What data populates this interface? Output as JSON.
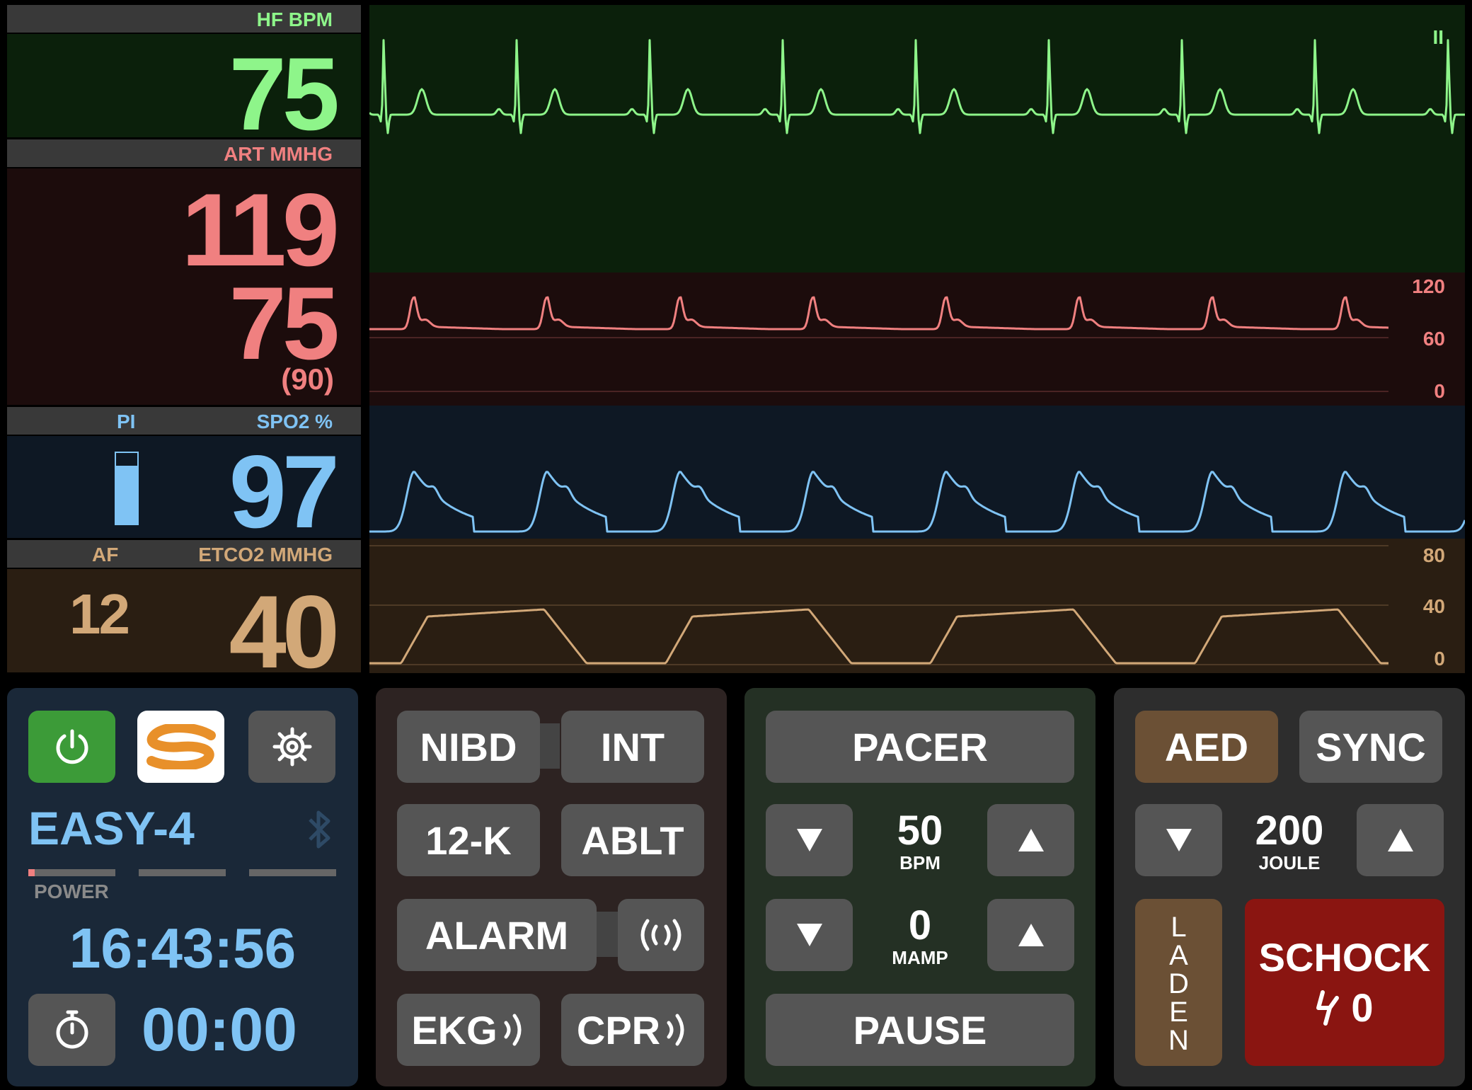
{
  "colors": {
    "hr": "#8ef58a",
    "art": "#f08080",
    "spo2": "#7fc3f4",
    "etco2": "#d2a878",
    "power_green": "#3c9b38",
    "aed_brown": "#6b5035",
    "schock_red": "#8a1511",
    "clock_blue": "#7fc3f4"
  },
  "hr": {
    "label": "HF  BPM",
    "value": "75"
  },
  "art": {
    "label": "ART  MMHG",
    "systolic": "119",
    "diastolic": "75",
    "mean": "(90)",
    "scale": [
      "120",
      "60",
      "0"
    ]
  },
  "spo2": {
    "pi_label": "PI",
    "label": "SPO2  %",
    "value": "97",
    "pi_level": 0.82
  },
  "etco2": {
    "af_label": "AF",
    "label": "ETCO2  MMHG",
    "af_value": "12",
    "value": "40",
    "scale": [
      "80",
      "40",
      "0"
    ]
  },
  "pause_indicator": "II",
  "device": {
    "name": "EASY-4",
    "power_label": "POWER",
    "power_level": 0.07,
    "time": "16:43:56",
    "timer": "00:00",
    "icons": [
      "power-icon",
      "logo",
      "gear-icon",
      "bluetooth-icon",
      "stopwatch-icon"
    ]
  },
  "functions": {
    "nibd": "NIBD",
    "int": "INT",
    "ecg12": "12-K",
    "ablt": "ABLT",
    "alarm": "ALARM",
    "ekg": "EKG",
    "cpr": "CPR"
  },
  "pacer": {
    "title": "PACER",
    "rate": "50",
    "rate_unit": "BPM",
    "current": "0",
    "current_unit": "MAMP",
    "pause": "PAUSE"
  },
  "defib": {
    "aed": "AED",
    "sync": "SYNC",
    "energy": "200",
    "energy_unit": "JOULE",
    "charge": "LADEN",
    "shock": "SCHOCK",
    "shock_count": "0"
  }
}
